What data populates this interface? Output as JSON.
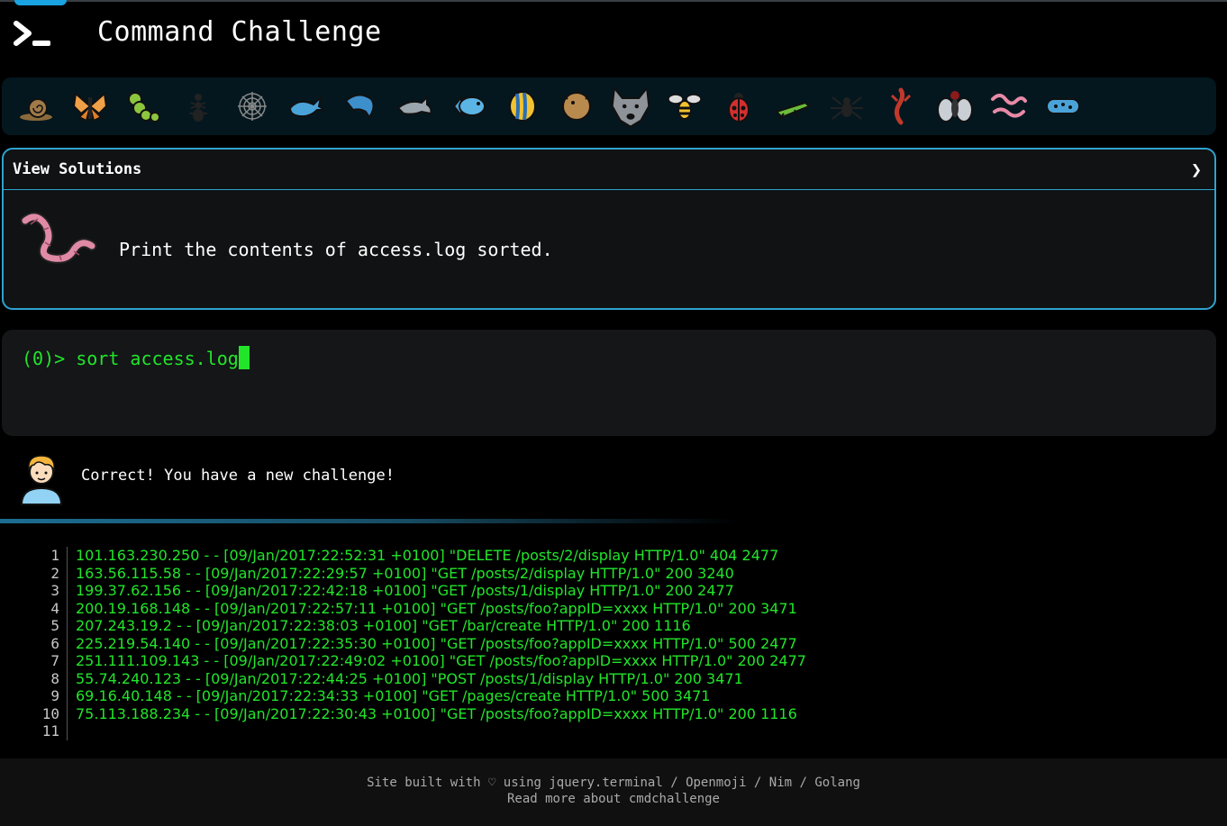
{
  "header": {
    "title": "Command Challenge",
    "logo_icon": "terminal-prompt-icon"
  },
  "challenges": [
    {
      "name": "snail",
      "icon": "snail-icon"
    },
    {
      "name": "butterfly",
      "icon": "butterfly-icon"
    },
    {
      "name": "caterpillar",
      "icon": "caterpillar-icon"
    },
    {
      "name": "ant",
      "icon": "ant-icon"
    },
    {
      "name": "spider-web",
      "icon": "spider-web-icon"
    },
    {
      "name": "whale",
      "icon": "whale-icon"
    },
    {
      "name": "dolphin",
      "icon": "dolphin-icon"
    },
    {
      "name": "dolphin-gray",
      "icon": "dolphin-icon"
    },
    {
      "name": "fish",
      "icon": "fish-icon"
    },
    {
      "name": "tropical-fish",
      "icon": "tropical-fish-icon"
    },
    {
      "name": "blowfish",
      "icon": "blowfish-icon"
    },
    {
      "name": "wolf",
      "icon": "wolf-icon"
    },
    {
      "name": "bee",
      "icon": "bee-icon"
    },
    {
      "name": "ladybug",
      "icon": "ladybug-icon"
    },
    {
      "name": "cricket",
      "icon": "cricket-icon"
    },
    {
      "name": "spider",
      "icon": "spider-icon"
    },
    {
      "name": "scorpion",
      "icon": "scorpion-icon"
    },
    {
      "name": "fly",
      "icon": "fly-icon"
    },
    {
      "name": "worm",
      "icon": "worm-icon"
    },
    {
      "name": "microbe",
      "icon": "microbe-icon"
    }
  ],
  "solutions": {
    "title": "View Solutions",
    "chevron": "❯",
    "task": "Print the contents of access.log sorted."
  },
  "terminal": {
    "prompt": "(0)> ",
    "command": "sort access.log"
  },
  "message": {
    "text": "Correct! You have a new challenge!"
  },
  "output": {
    "lines": [
      {
        "n": "1",
        "text": "101.163.230.250 - - [09/Jan/2017:22:52:31 +0100] \"DELETE /posts/2/display HTTP/1.0\" 404 2477"
      },
      {
        "n": "2",
        "text": "163.56.115.58 - - [09/Jan/2017:22:29:57 +0100] \"GET /posts/2/display HTTP/1.0\" 200 3240"
      },
      {
        "n": "3",
        "text": "199.37.62.156 - - [09/Jan/2017:22:42:18 +0100] \"GET /posts/1/display HTTP/1.0\" 200 2477"
      },
      {
        "n": "4",
        "text": "200.19.168.148 - - [09/Jan/2017:22:57:11 +0100] \"GET /posts/foo?appID=xxxx HTTP/1.0\" 200 3471"
      },
      {
        "n": "5",
        "text": "207.243.19.2 - - [09/Jan/2017:22:38:03 +0100] \"GET /bar/create HTTP/1.0\" 200 1116"
      },
      {
        "n": "6",
        "text": "225.219.54.140 - - [09/Jan/2017:22:35:30 +0100] \"GET /posts/foo?appID=xxxx HTTP/1.0\" 500 2477"
      },
      {
        "n": "7",
        "text": "251.111.109.143 - - [09/Jan/2017:22:49:02 +0100] \"GET /posts/foo?appID=xxxx HTTP/1.0\" 200 2477"
      },
      {
        "n": "8",
        "text": "55.74.240.123 - - [09/Jan/2017:22:44:25 +0100] \"POST /posts/1/display HTTP/1.0\" 200 3471"
      },
      {
        "n": "9",
        "text": "69.16.40.148 - - [09/Jan/2017:22:34:33 +0100] \"GET /pages/create HTTP/1.0\" 500 3471"
      },
      {
        "n": "10",
        "text": "75.113.188.234 - - [09/Jan/2017:22:30:43 +0100] \"GET /posts/foo?appID=xxxx HTTP/1.0\" 200 1116"
      },
      {
        "n": "11",
        "text": ""
      }
    ]
  },
  "footer": {
    "line1": "Site built with ♡ using jquery.terminal / Openmoji / Nim / Golang",
    "line2": "Read more about cmdchallenge"
  },
  "colors": {
    "accent": "#2ea3cf",
    "terminal_green": "#22e52a",
    "strip_bg": "#04171f"
  }
}
